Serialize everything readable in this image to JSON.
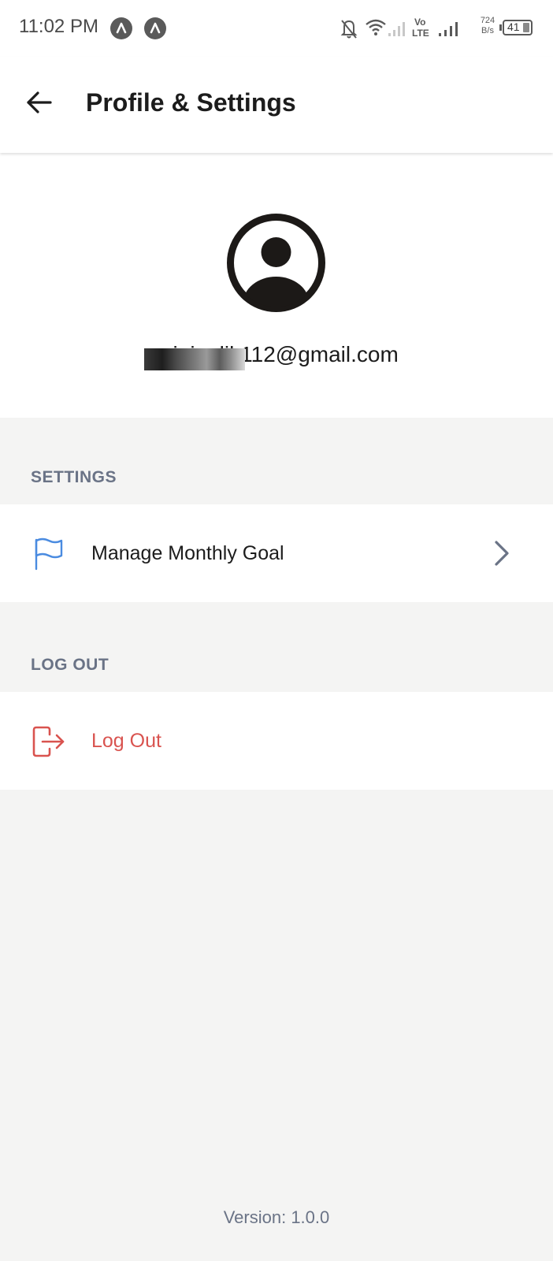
{
  "status_bar": {
    "time": "11:02 PM",
    "net_speed_value": "724",
    "net_speed_unit": "B/s",
    "battery": "41",
    "network": "Vo LTE",
    "icons": [
      "app-notification-icon",
      "app-notification-icon",
      "bell-off-icon",
      "wifi-icon",
      "signal-icon",
      "volte-icon",
      "signal-icon",
      "battery-icon"
    ]
  },
  "header": {
    "title": "Profile & Settings",
    "back_icon": "arrow-left-icon"
  },
  "profile": {
    "avatar_icon": "user-circle-icon",
    "email_visible_part": "?@gmail.com",
    "email_partial": "mininalik112@gmail.com"
  },
  "settings_section": {
    "header": "SETTINGS",
    "items": [
      {
        "label": "Manage Monthly Goal",
        "icon": "flag-icon",
        "trailing_icon": "chevron-right-icon"
      }
    ]
  },
  "logout_section": {
    "header": "LOG OUT",
    "items": [
      {
        "label": "Log Out",
        "icon": "logout-icon"
      }
    ]
  },
  "footer": {
    "version": "Version: 1.0.0"
  },
  "colors": {
    "accent_blue": "#4a8be0",
    "danger_red": "#d9534f",
    "section_text": "#6a7386",
    "background": "#f4f4f3"
  }
}
